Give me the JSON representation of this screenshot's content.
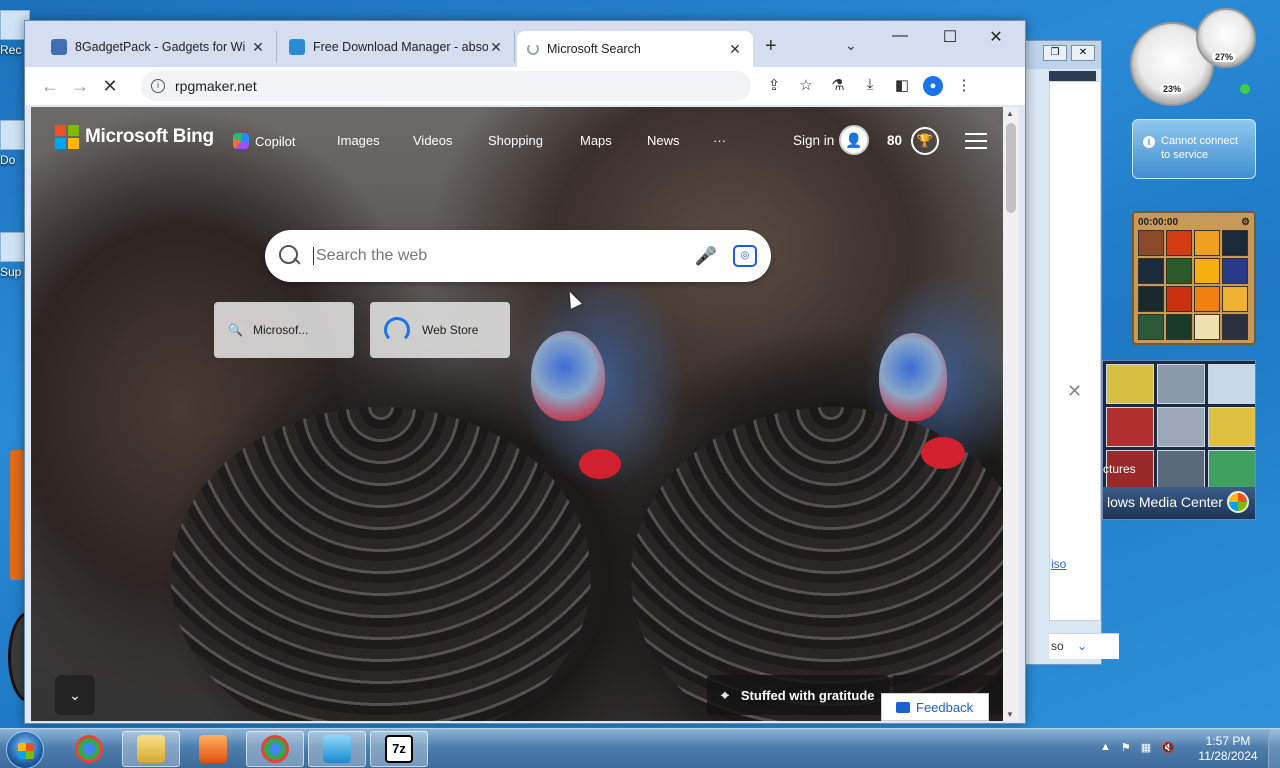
{
  "desktop": {
    "icons": [
      "Rec",
      "Do",
      "Sup"
    ]
  },
  "browser": {
    "tabs": [
      {
        "title": "8GadgetPack - Gadgets for Wi",
        "fav_color": "#3f6fb0"
      },
      {
        "title": "Free Download Manager - abso",
        "fav_color": "#2a8ad6"
      },
      {
        "title": "Microsoft Search",
        "fav_color": "#999999"
      }
    ],
    "new_tab_symbol": "+",
    "tab_menu_symbol": "⌄",
    "window_controls": {
      "minimize": "—",
      "maximize": "☐",
      "close": "✕"
    },
    "url": "rpgmaker.net"
  },
  "bing": {
    "logo_text": "Microsoft Bing",
    "nav": [
      "Copilot",
      "Images",
      "Videos",
      "Shopping",
      "Maps",
      "News",
      "···"
    ],
    "signin": "Sign in",
    "points": "80",
    "search_placeholder": "Search the web",
    "quick_links": [
      {
        "label": "Microsof..."
      },
      {
        "label": "Web Store"
      }
    ],
    "caption": "Stuffed with gratitude",
    "feedback": "Feedback"
  },
  "gadgets": {
    "cpu_percent": "23%",
    "mem_percent": "27%",
    "weather_message": "Cannot connect to service",
    "puzzle_timer": "00:00:00",
    "media_center_label": "lows Media Center",
    "pictures_label": "ctures"
  },
  "background_window": {
    "link_fragment": "iso",
    "bottom_fragment": "so"
  },
  "taskbar": {
    "time": "1:57 PM",
    "date": "11/28/2024",
    "apps": [
      "Chrome",
      "Explorer",
      "Media Player",
      "Chrome",
      "Free Download Manager",
      "7-Zip"
    ],
    "sevenzip_label": "7z"
  },
  "colors": {
    "accent": "#1a5fd6",
    "ms_red": "#f25022",
    "ms_green": "#7fba00",
    "ms_blue": "#00a4ef",
    "ms_yellow": "#ffb900"
  }
}
